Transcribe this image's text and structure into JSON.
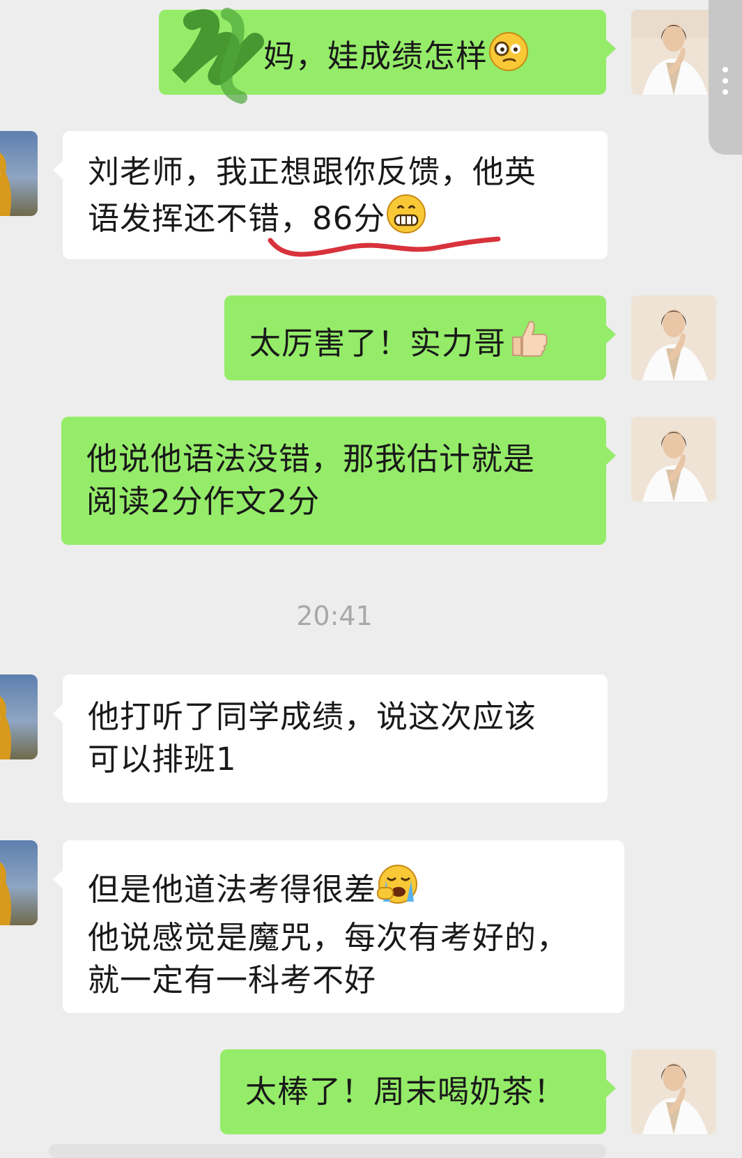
{
  "messages": [
    {
      "id": "m1",
      "sender": "me",
      "text": "妈，娃成绩怎样",
      "emoji": "monocle-face-emoji"
    },
    {
      "id": "m2",
      "sender": "them",
      "line1": "刘老师，我正想跟你反馈，他英",
      "line2": "语发挥还不错，86分",
      "emoji": "grinning-face-emoji"
    },
    {
      "id": "m3",
      "sender": "me",
      "text": "太厉害了！实力哥",
      "emoji": "thumbs-up-emoji"
    },
    {
      "id": "m4",
      "sender": "me",
      "line1": "他说他语法没错，那我估计就是",
      "line2": "阅读2分作文2分"
    },
    {
      "id": "m5",
      "sender": "them",
      "line1": "他打听了同学成绩，说这次应该",
      "line2": "可以排班1"
    },
    {
      "id": "m6",
      "sender": "them",
      "line1": "但是他道法考得很差",
      "line2": "他说感觉是魔咒，每次有考好的，",
      "line3": "就一定有一科考不好",
      "emoji": "loudly-crying-face-emoji"
    },
    {
      "id": "m7",
      "sender": "me",
      "text": "太棒了！周末喝奶茶！"
    }
  ],
  "timestamp": "20:41",
  "colors": {
    "background": "#ededed",
    "bubble_me": "#95ec69",
    "bubble_them": "#ffffff",
    "annotation": "#d8323c",
    "redaction": "#3e8f2a"
  }
}
